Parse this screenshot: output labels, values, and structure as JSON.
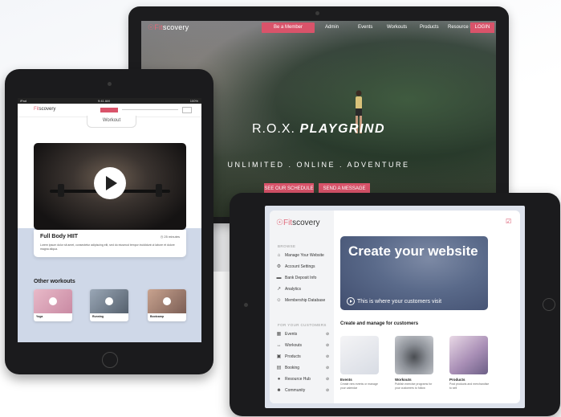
{
  "colors": {
    "accent": "#d9536a",
    "tablet_frame": "#1b1b1d",
    "band_blue": "#cfd8e8",
    "hero_blue": "#5a6a8a"
  },
  "desktop": {
    "logo_mark": "☉",
    "logo_accent": "Fit",
    "logo_rest": "scovery",
    "member_button": "Be a Member",
    "nav": [
      "Admin",
      "Events",
      "Workouts",
      "Products",
      "Resource Hub"
    ],
    "login_button": "LOGIN",
    "hero_title_plain": "R.O.X.",
    "hero_title_bold": "PLAYGRIND",
    "hero_subtitle": "UNLIMITED . ONLINE . ADVENTURE",
    "schedule_button": "SEE OUR SCHEDULE",
    "message_button": "SEND A MESSAGE"
  },
  "tablet_left": {
    "status_left": "iPad",
    "status_center": "9:41 AM",
    "status_right": "100%",
    "logo_accent": "Fit",
    "logo_rest": "scovery",
    "tab_label": "Workout",
    "video_title": "Full Body HIIT",
    "video_duration": "25 minutes",
    "video_description": "Lorem ipsum dolor sit amet, consectetur adipiscing elit, sed do eiusmod tempor incididunt ut labore et dolore magna aliqua.",
    "other_heading": "Other workouts",
    "other_workouts": [
      "Yoga",
      "Running",
      "Bootcamp"
    ]
  },
  "tablet_right": {
    "logo_accent": "Fit",
    "logo_rest": "scovery",
    "browse_label": "BROWSE",
    "browse_items": [
      {
        "icon": "home-icon",
        "glyph": "⌂",
        "label": "Manage Your Website"
      },
      {
        "icon": "gear-icon",
        "glyph": "⚙",
        "label": "Account Settings"
      },
      {
        "icon": "bank-icon",
        "glyph": "▬",
        "label": "Bank Deposit Info"
      },
      {
        "icon": "analytics-icon",
        "glyph": "↗",
        "label": "Analytics"
      },
      {
        "icon": "membership-icon",
        "glyph": "☺",
        "label": "Membership Database"
      }
    ],
    "customers_label": "FOR YOUR CUSTOMERS",
    "customer_items": [
      {
        "icon": "calendar-icon",
        "glyph": "▦",
        "label": "Events"
      },
      {
        "icon": "dumbbell-icon",
        "glyph": "↔",
        "label": "Workouts"
      },
      {
        "icon": "bag-icon",
        "glyph": "▣",
        "label": "Products"
      },
      {
        "icon": "booking-icon",
        "glyph": "▤",
        "label": "Booking"
      },
      {
        "icon": "resource-icon",
        "glyph": "●",
        "label": "Resource Hub"
      },
      {
        "icon": "community-icon",
        "glyph": "☻",
        "label": "Community"
      }
    ],
    "hero_title": "Create your website",
    "hero_subtitle": "This is where your customers visit",
    "section_heading": "Create and manage for customers",
    "cards": [
      {
        "title": "Events",
        "desc": "Create new events or manage your calendar"
      },
      {
        "title": "Workouts",
        "desc": "Publish exercise programs for your customers to follow"
      },
      {
        "title": "Products",
        "desc": "Post products and merchandise to sell"
      }
    ]
  }
}
